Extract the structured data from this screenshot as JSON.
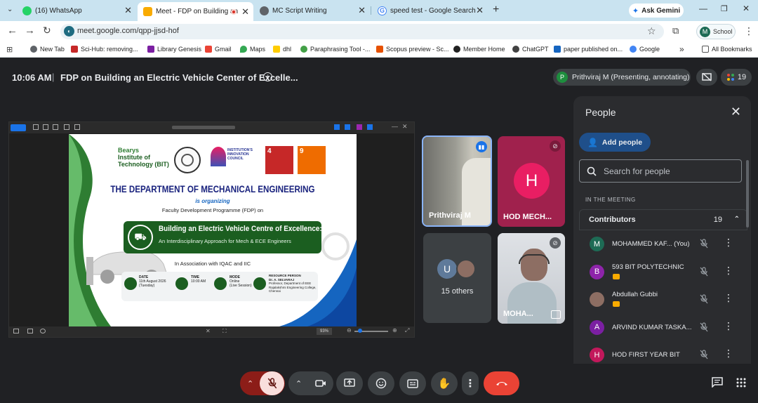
{
  "browser": {
    "tabs": [
      {
        "label": "(16) WhatsApp",
        "color": "#25d366"
      },
      {
        "label": "Meet - FDP on Building an",
        "color": "#f9ab00",
        "active": true
      },
      {
        "label": "MC Script Writing",
        "color": "#5f6368"
      },
      {
        "label": "speed test - Google Search",
        "color": "#4285f4"
      }
    ],
    "new_tab": "+",
    "ask_gemini": "Ask Gemini",
    "url": "meet.google.com/qpp-jjsd-hof",
    "profile_label": "School",
    "profile_initial": "M",
    "bookmarks": [
      {
        "label": "New Tab",
        "color": "#5f6368"
      },
      {
        "label": "Sci-Hub: removing...",
        "color": "#c62828"
      },
      {
        "label": "Library Genesis",
        "color": "#7b1fa2"
      },
      {
        "label": "Gmail",
        "color": "#ea4335"
      },
      {
        "label": "Maps",
        "color": "#34a853"
      },
      {
        "label": "dhl",
        "color": "#ffcc00"
      },
      {
        "label": "Paraphrasing Tool -...",
        "color": "#43a047"
      },
      {
        "label": "Scopus preview - Sc...",
        "color": "#e65100"
      },
      {
        "label": "Member Home",
        "color": "#212121"
      },
      {
        "label": "ChatGPT",
        "color": "#424242"
      },
      {
        "label": "paper published on...",
        "color": "#1565c0"
      },
      {
        "label": "Google",
        "color": "#4285f4"
      }
    ],
    "more_bookmarks": "»",
    "all_bookmarks": "All Bookmarks"
  },
  "meet": {
    "time": "10:06 AM",
    "separator": "|",
    "meeting_title": "FDP on Building an Electric Vehicle Center of Excelle...",
    "presenter_initial": "P",
    "presenter_label": "Prithviraj M (Presenting, annotating)",
    "participant_count": "19"
  },
  "slide": {
    "institute_line1": "Bearys",
    "institute_line2": "Institute of",
    "institute_line3": "Technology (BIT)",
    "iic_line1": "INSTITUTION'S",
    "iic_line2": "INNOVATION",
    "iic_line3": "COUNCIL",
    "sdg4": "4",
    "sdg9": "9",
    "department": "THE DEPARTMENT OF MECHANICAL ENGINEERING",
    "organizing": "is organizing",
    "programme": "Faculty Development Programme (FDP) on",
    "headline": "Building an Electric Vehicle Centre of Excellence:",
    "subheadline": "An Interdisciplinary Approach for Mech & ECE Engineers",
    "association": "In Association with IQAC and IIC",
    "date_label": "DATE",
    "date_value": "11th August 2026",
    "date_day": "(Tuesday)",
    "time_label": "TIME",
    "time_value": "10:00 AM",
    "mode_label": "MODE",
    "mode_value": "Online",
    "mode_sub": "(Live Session)",
    "resource_label": "RESOURCE PERSON",
    "resource_name": "Dr. A. SELVARAJ",
    "resource_line1": "Professor, Department of EEE",
    "resource_line2": "Rajalakshmi Engineering College,",
    "resource_line3": "Chennai",
    "zoom": "93%"
  },
  "tiles": [
    {
      "name": "Prithviraj M"
    },
    {
      "name": "HOD MECH...",
      "initial": "H"
    },
    {
      "name": "15 others",
      "initial": "U"
    },
    {
      "name": "MOHA..."
    }
  ],
  "people_panel": {
    "title": "People",
    "add_people": "Add people",
    "search_placeholder": "Search for people",
    "in_meeting": "IN THE MEETING",
    "contributors_label": "Contributors",
    "contributors_count": "19",
    "participants": [
      {
        "initial": "M",
        "name": "MOHAMMED KAF... (You)",
        "color": "#1e6b55",
        "badge": false
      },
      {
        "initial": "B",
        "name": "593 BIT POLYTECHNIC",
        "color": "#8e24aa",
        "badge": true
      },
      {
        "initial": "",
        "name": "Abdullah Gubbi",
        "color": "#8d6e63",
        "badge": true
      },
      {
        "initial": "A",
        "name": "ARVIND KUMAR TASKA...",
        "color": "#7b1fa2",
        "badge": false
      },
      {
        "initial": "H",
        "name": "HOD FIRST YEAR BIT",
        "color": "#c2185b",
        "badge": false
      }
    ]
  }
}
